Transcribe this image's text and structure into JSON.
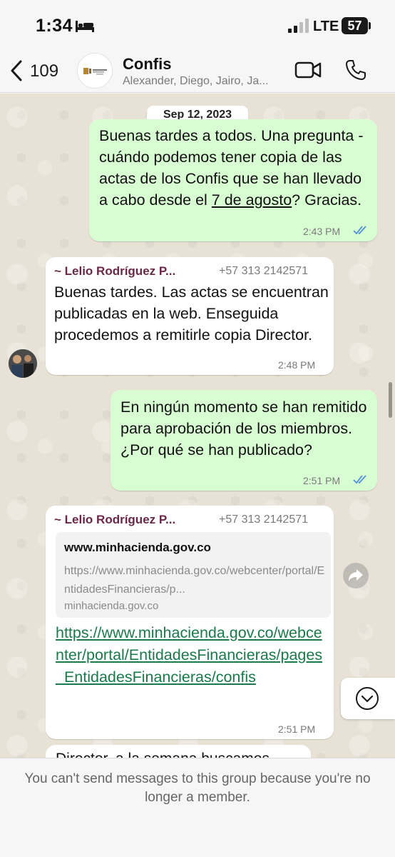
{
  "status_bar": {
    "time": "1:34",
    "network": "LTE",
    "battery": "57"
  },
  "header": {
    "back_count": "109",
    "group_name": "Confis",
    "members": "Alexander, Diego, Jairo, Ja..."
  },
  "chat": {
    "date_label": "Sep 12, 2023",
    "messages": [
      {
        "direction": "out",
        "text_before": "Buenas tardes a todos. Una pregunta - cuándo podemos tener copia de las actas de los Confis que se han llevado a cabo desde el ",
        "text_link": "7 de agosto",
        "text_after": "? Gracias.",
        "time": "2:43 PM"
      },
      {
        "direction": "in",
        "sender": "~ Lelio Rodríguez P...",
        "phone": "+57 313 2142571",
        "text": "Buenas tardes. Las actas se encuentran publicadas en la web. Enseguida procedemos a remitirle copia Director.",
        "time": "2:48 PM"
      },
      {
        "direction": "out",
        "text": "En ningún momento se han remitido para aprobación de los miembros. ¿Por qué se han publicado?",
        "time": "2:51 PM"
      },
      {
        "direction": "in",
        "sender": "~ Lelio Rodríguez P...",
        "phone": "+57 313 2142571",
        "preview_title": "www.minhacienda.gov.co",
        "preview_desc": "https://www.minhacienda.gov.co/webcenter/portal/EntidadesFinancieras/p...",
        "preview_domain": "minhacienda.gov.co",
        "link": "https://www.minhacienda.gov.co/webcenter/portal/EntidadesFinancieras/pages_EntidadesFinancieras/confis",
        "time": "2:51 PM"
      },
      {
        "direction": "in",
        "partial_text": "Director, a la semana buscamos"
      }
    ]
  },
  "footer": {
    "notice": "You can't send messages to this group because you're no longer a member."
  },
  "colors": {
    "outgoing_bubble": "#d9fdd3",
    "incoming_bubble": "#ffffff",
    "sender_name": "#6a2848",
    "link": "#1a7a4a",
    "read_ticks": "#4f8fd8"
  }
}
